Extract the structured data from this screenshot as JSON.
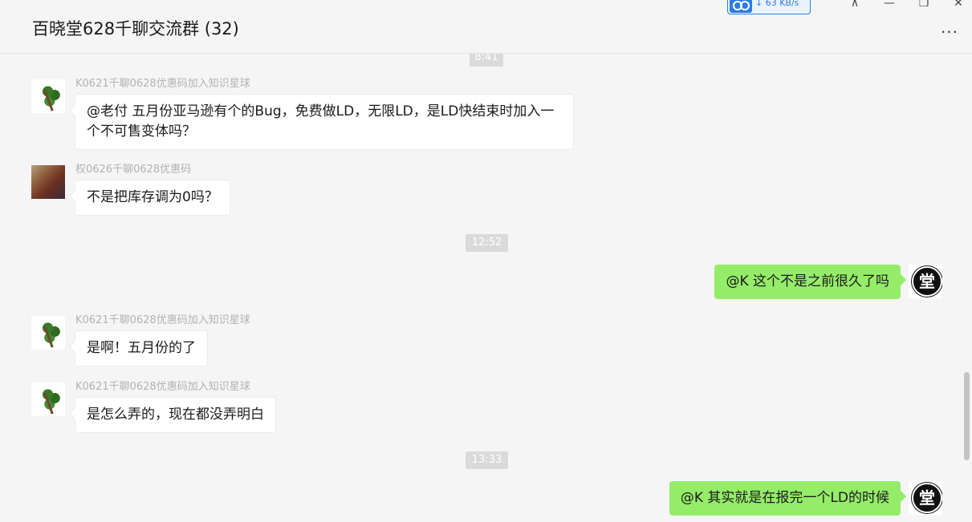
{
  "header": {
    "title": "百晓堂628千聊交流群 (32)",
    "net_speed": "63 KB/s",
    "window_controls": {
      "pin": "⊼",
      "minimize": "—",
      "restore": "❐",
      "close": "✕"
    },
    "more": "..."
  },
  "messages": [
    {
      "type": "time",
      "text": "8:41"
    },
    {
      "type": "in",
      "sender": "K0621千聊0628优惠码加入知识星球",
      "avatar": "tree-avatar",
      "text": "@老付 五月份亚马逊有个的Bug，免费做LD，无限LD，是LD快结束时加入一个不可售变体吗？"
    },
    {
      "type": "in",
      "sender": "权0626千聊0628优惠码",
      "avatar": "photo-avatar",
      "text": "不是把库存调为0吗？"
    },
    {
      "type": "time",
      "text": "12:52"
    },
    {
      "type": "out",
      "avatar": "self-avatar",
      "avatar_glyph": "堂",
      "text": "@K 这个不是之前很久了吗"
    },
    {
      "type": "in",
      "sender": "K0621千聊0628优惠码加入知识星球",
      "avatar": "tree-avatar",
      "text": "是啊！五月份的了"
    },
    {
      "type": "in",
      "sender": "K0621千聊0628优惠码加入知识星球",
      "avatar": "tree-avatar",
      "text": "是怎么弄的，现在都没弄明白"
    },
    {
      "type": "time",
      "text": "13:33"
    },
    {
      "type": "out",
      "avatar": "self-avatar",
      "avatar_glyph": "堂",
      "text": "@K 其实就是在报完一个LD的时候"
    }
  ],
  "colors": {
    "out_bubble": "#95ec69",
    "in_bubble": "#ffffff",
    "background": "#f5f5f5",
    "time_pill": "#dadada"
  }
}
